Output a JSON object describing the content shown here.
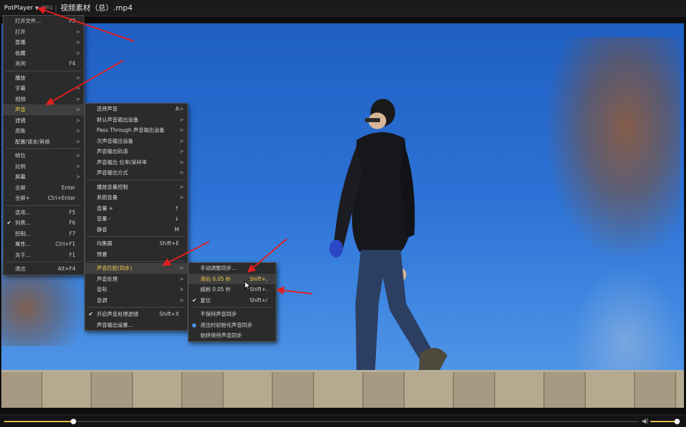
{
  "title_bar": {
    "app_name": "PotPlayer",
    "format": "MP4",
    "file_title": "视频素材（总）.mp4"
  },
  "main_menu": [
    {
      "label": "打开文件...",
      "shortcut": "F3",
      "arrow": ""
    },
    {
      "label": "打开",
      "shortcut": "",
      "arrow": ">"
    },
    {
      "label": "直播",
      "shortcut": "",
      "arrow": ">"
    },
    {
      "label": "收藏",
      "shortcut": "",
      "arrow": ">"
    },
    {
      "label": "关闭",
      "shortcut": "F4",
      "arrow": ""
    },
    {
      "separator": true
    },
    {
      "label": "播放",
      "shortcut": "",
      "arrow": ">"
    },
    {
      "label": "字幕",
      "shortcut": "",
      "arrow": ">"
    },
    {
      "label": "视频",
      "shortcut": "",
      "arrow": ">"
    },
    {
      "label": "声音",
      "shortcut": "",
      "arrow": ">",
      "highlighted": true
    },
    {
      "label": "滤镜",
      "shortcut": "",
      "arrow": ">"
    },
    {
      "label": "皮肤",
      "shortcut": "",
      "arrow": ">"
    },
    {
      "label": "配置/语言/其他",
      "shortcut": "",
      "arrow": ">"
    },
    {
      "separator": true
    },
    {
      "label": "帧位",
      "shortcut": "",
      "arrow": ">"
    },
    {
      "label": "比例",
      "shortcut": "",
      "arrow": ">"
    },
    {
      "label": "屏幕",
      "shortcut": "",
      "arrow": ">"
    },
    {
      "label": "全屏",
      "shortcut": "Enter",
      "arrow": ""
    },
    {
      "label": "全屏+",
      "shortcut": "Ctrl+Enter",
      "arrow": ""
    },
    {
      "separator": true
    },
    {
      "label": "选项...",
      "shortcut": "F5",
      "arrow": ""
    },
    {
      "label": "列表...",
      "shortcut": "F6",
      "arrow": "",
      "check": "✔"
    },
    {
      "label": "控制...",
      "shortcut": "F7",
      "arrow": ""
    },
    {
      "label": "属性...",
      "shortcut": "Ctrl+F1",
      "arrow": ""
    },
    {
      "label": "关于...",
      "shortcut": "F1",
      "arrow": ""
    },
    {
      "separator": true
    },
    {
      "label": "退出",
      "shortcut": "Alt+F4",
      "arrow": ""
    }
  ],
  "audio_menu": [
    {
      "label": "选择声音",
      "shortcut": "A",
      "arrow": ">"
    },
    {
      "label": "默认声音输出设备",
      "shortcut": "",
      "arrow": ">"
    },
    {
      "label": "Pass Through 声音输出设备",
      "shortcut": "",
      "arrow": ">"
    },
    {
      "label": "次声音输出设备",
      "shortcut": "",
      "arrow": ">"
    },
    {
      "label": "声音输出轨道",
      "shortcut": "",
      "arrow": ">"
    },
    {
      "label": "声音输出 位率/采样率",
      "shortcut": "",
      "arrow": ">"
    },
    {
      "label": "声音输出方式",
      "shortcut": "",
      "arrow": ">"
    },
    {
      "separator": true
    },
    {
      "label": "播放音量控制",
      "shortcut": "",
      "arrow": ">"
    },
    {
      "label": "系统音量",
      "shortcut": "",
      "arrow": ">"
    },
    {
      "label": "音量 +",
      "shortcut": "↑",
      "arrow": ""
    },
    {
      "label": "音量 -",
      "shortcut": "↓",
      "arrow": ""
    },
    {
      "label": "静音",
      "shortcut": "M",
      "arrow": ""
    },
    {
      "separator": true
    },
    {
      "label": "均衡器",
      "shortcut": "Shift+E",
      "arrow": ""
    },
    {
      "label": "预置",
      "shortcut": "",
      "arrow": ""
    },
    {
      "separator": true
    },
    {
      "label": "声音匹配(同步)",
      "shortcut": "",
      "arrow": ">",
      "highlighted": true
    },
    {
      "label": "声音处理",
      "shortcut": "",
      "arrow": ">"
    },
    {
      "label": "音轨",
      "shortcut": "",
      "arrow": ">"
    },
    {
      "label": "音调",
      "shortcut": "",
      "arrow": ">"
    },
    {
      "separator": true
    },
    {
      "label": "开启声音处理滤镜",
      "shortcut": "Shift+X",
      "arrow": "",
      "check": "✔"
    },
    {
      "label": "声音输出设置...",
      "shortcut": "",
      "arrow": ""
    }
  ],
  "sync_menu": [
    {
      "label": "手动调整同步...",
      "shortcut": "",
      "arrow": ""
    },
    {
      "label": "滞后 0.05 秒",
      "shortcut": "Shift+,",
      "arrow": "",
      "highlighted": true
    },
    {
      "label": "超前 0.05 秒",
      "shortcut": "Shift+.",
      "arrow": ""
    },
    {
      "label": "复位",
      "shortcut": "Shift+/",
      "arrow": "",
      "check": "✔"
    },
    {
      "separator": true
    },
    {
      "label": "不保持声音同步",
      "shortcut": "",
      "arrow": ""
    },
    {
      "label": "退出时初始化声音同步",
      "shortcut": "",
      "arrow": "",
      "radio": true
    },
    {
      "label": "始终保持声音同步",
      "shortcut": "",
      "arrow": ""
    }
  ],
  "player": {
    "seek_progress": 0.109,
    "volume_level": 0.93
  },
  "colors": {
    "highlight_text": "#f2c84b",
    "accent_bar": "#e6c34a",
    "annotation_arrow": "#e02020",
    "radio_dot": "#4f8fe6"
  }
}
